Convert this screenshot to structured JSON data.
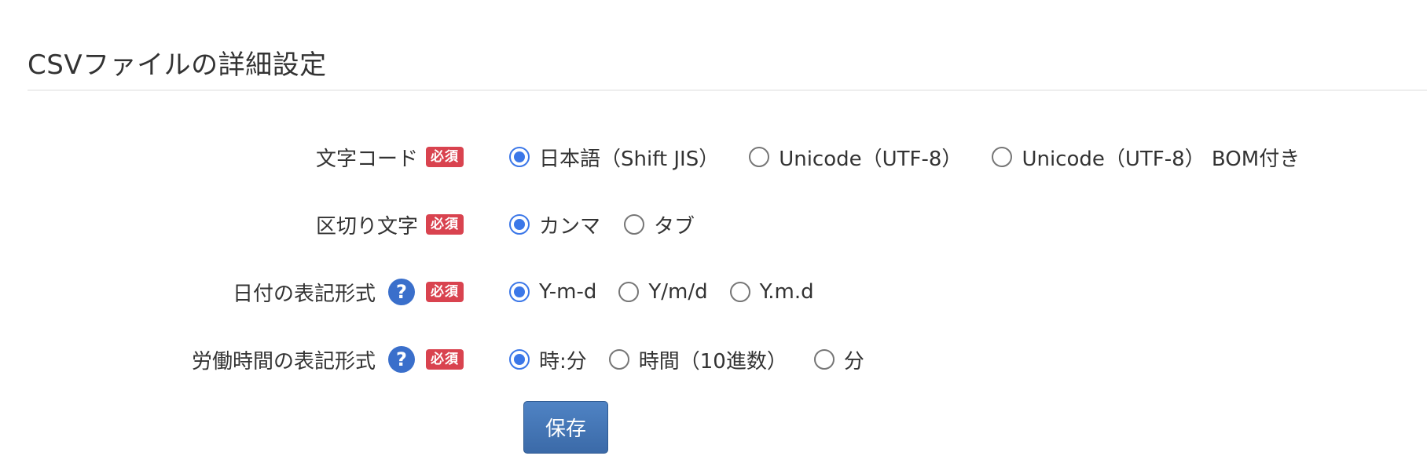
{
  "page_title": "CSVファイルの詳細設定",
  "required_label": "必須",
  "help_icon_glyph": "?",
  "colors": {
    "accent": "#3b77e8",
    "required_badge": "#d9434f",
    "help_icon": "#3a6fcb",
    "save_button": "#4577b8"
  },
  "fields": [
    {
      "label": "文字コード",
      "has_help": false,
      "options": [
        "日本語（Shift JIS）",
        "Unicode（UTF-8）",
        "Unicode（UTF-8） BOM付き"
      ],
      "selected": 0
    },
    {
      "label": "区切り文字",
      "has_help": false,
      "options": [
        "カンマ",
        "タブ"
      ],
      "selected": 0
    },
    {
      "label": "日付の表記形式",
      "has_help": true,
      "options": [
        "Y-m-d",
        "Y/m/d",
        "Y.m.d"
      ],
      "selected": 0
    },
    {
      "label": "労働時間の表記形式",
      "has_help": true,
      "options": [
        "時:分",
        "時間（10進数）",
        "分"
      ],
      "selected": 0
    }
  ],
  "save_label": "保存"
}
